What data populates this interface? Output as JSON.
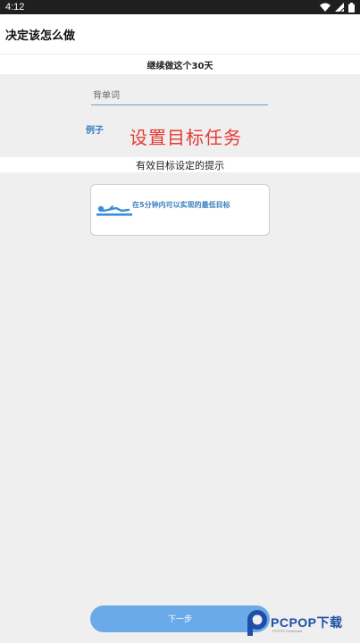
{
  "status_bar": {
    "time": "4:12",
    "icons": [
      "wifi-icon",
      "signal-icon",
      "battery-icon"
    ]
  },
  "header": {
    "title": "决定该怎么做"
  },
  "continue_band": {
    "text": "继续做这个30天"
  },
  "goal_input": {
    "placeholder": "背单词",
    "value": ""
  },
  "example": {
    "label": "例子"
  },
  "overlay": {
    "title": "设置目标任务",
    "color": "#e53935"
  },
  "tips_band": {
    "text": "有效目标设定的提示"
  },
  "tip_card": {
    "icon": "lying-person-icon",
    "text": "在5分钟内可以实现的最低目标"
  },
  "next_button": {
    "label": "下一步",
    "color": "#6aaae8"
  },
  "watermark": {
    "brand": "PCPOP下载",
    "sub": "PCPOP Download"
  }
}
